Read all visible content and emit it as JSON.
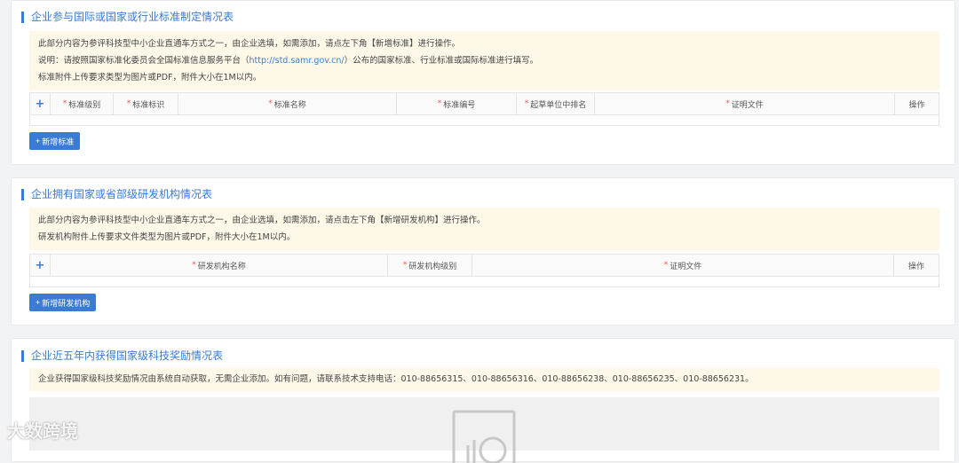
{
  "section1": {
    "title": "企业参与国际或国家或行业标准制定情况表",
    "notice_line1": "此部分内容为参评科技型中小企业直通车方式之一，由企业选填，如需添加，请点左下角【新增标准】进行操作。",
    "notice_line2_pre": "说明：请按照国家标准化委员会全国标准信息服务平台（",
    "notice_link": "http://std.samr.gov.cn/",
    "notice_line2_post": "）公布的国家标准、行业标准或国际标准进行填写。",
    "notice_line3": "标准附件上传要求类型为图片或PDF，附件大小在1M以内。",
    "columns": [
      "标准级别",
      "标准标识",
      "标准名称",
      "标准编号",
      "起草单位中排名",
      "证明文件",
      "操作"
    ],
    "add_button": "新增标准"
  },
  "section2": {
    "title": "企业拥有国家或省部级研发机构情况表",
    "notice_line1": "此部分内容为参评科技型中小企业直通车方式之一，由企业选填，如需添加，请点击左下角【新增研发机构】进行操作。",
    "notice_line2": "研发机构附件上传要求文件类型为图片或PDF，附件大小在1M以内。",
    "columns": [
      "研发机构名称",
      "研发机构级别",
      "证明文件",
      "操作"
    ],
    "add_button": "新增研发机构"
  },
  "section3": {
    "title": "企业近五年内获得国家级科技奖励情况表",
    "notice": "企业获得国家级科技奖励情况由系统自动获取，无需企业添加。如有问题，请联系技术支持电话：010-88656315、010-88656316、010-88656238、010-88656235、010-88656231。"
  },
  "watermark": "大数跨境",
  "required_mark": "*",
  "plus": "+"
}
